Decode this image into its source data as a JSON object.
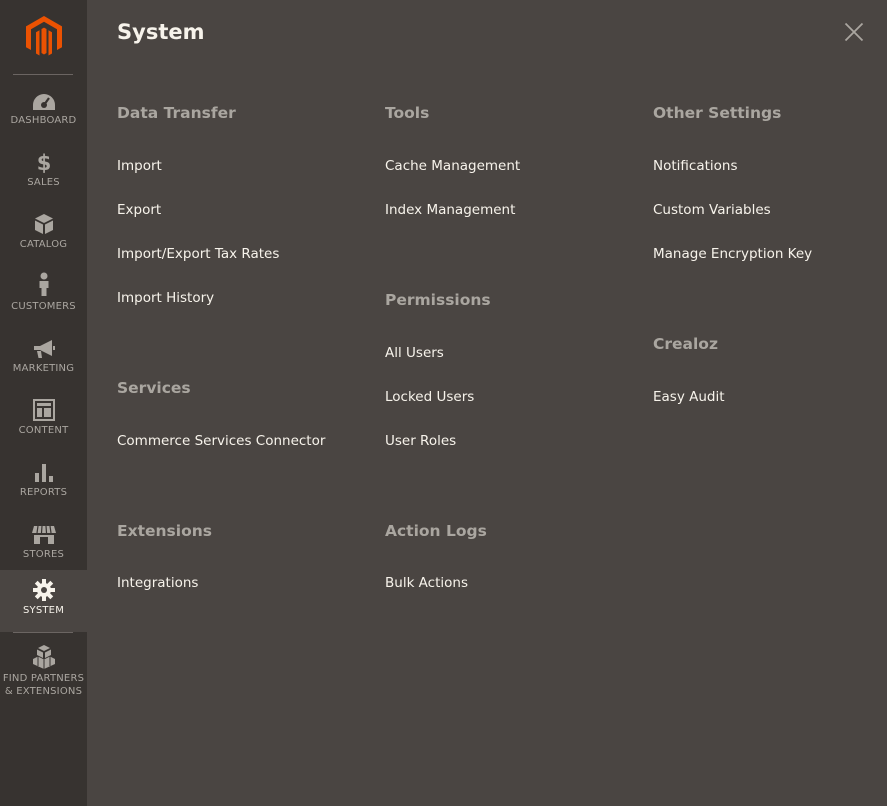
{
  "brand": {
    "logo_icon": "magento-logo-icon",
    "accent": "#eb5202"
  },
  "sidebar": {
    "items": [
      {
        "label": "DASHBOARD",
        "icon": "dashboard-icon"
      },
      {
        "label": "SALES",
        "icon": "dollar-icon"
      },
      {
        "label": "CATALOG",
        "icon": "box-icon"
      },
      {
        "label": "CUSTOMERS",
        "icon": "person-icon"
      },
      {
        "label": "MARKETING",
        "icon": "megaphone-icon"
      },
      {
        "label": "CONTENT",
        "icon": "layout-icon"
      },
      {
        "label": "REPORTS",
        "icon": "bar-chart-icon"
      },
      {
        "label": "STORES",
        "icon": "store-icon"
      },
      {
        "label": "SYSTEM",
        "icon": "gear-icon",
        "active": true
      },
      {
        "label": "FIND PARTNERS",
        "label2": "& EXTENSIONS",
        "icon": "blocks-icon"
      }
    ]
  },
  "panel": {
    "title": "System",
    "close_icon": "close-icon",
    "columns": [
      {
        "sections": [
          {
            "title": "Data Transfer",
            "links": [
              "Import",
              "Export",
              "Import/Export Tax Rates",
              "Import History"
            ]
          },
          {
            "title": "Services",
            "links": [
              "Commerce Services Connector"
            ]
          },
          {
            "title": "Extensions",
            "links": [
              "Integrations"
            ]
          }
        ]
      },
      {
        "sections": [
          {
            "title": "Tools",
            "links": [
              "Cache Management",
              "Index Management"
            ]
          },
          {
            "title": "Permissions",
            "links": [
              "All Users",
              "Locked Users",
              "User Roles"
            ]
          },
          {
            "title": "Action Logs",
            "links": [
              "Bulk Actions"
            ]
          }
        ]
      },
      {
        "sections": [
          {
            "title": "Other Settings",
            "links": [
              "Notifications",
              "Custom Variables",
              "Manage Encryption Key"
            ]
          },
          {
            "title": "Crealoz",
            "links": [
              "Easy Audit"
            ]
          }
        ]
      }
    ]
  },
  "colors": {
    "sidebar_bg": "#373330",
    "panel_bg": "#4a4542",
    "text_light": "#f7f3eb",
    "text_muted": "#aaa6a0"
  }
}
